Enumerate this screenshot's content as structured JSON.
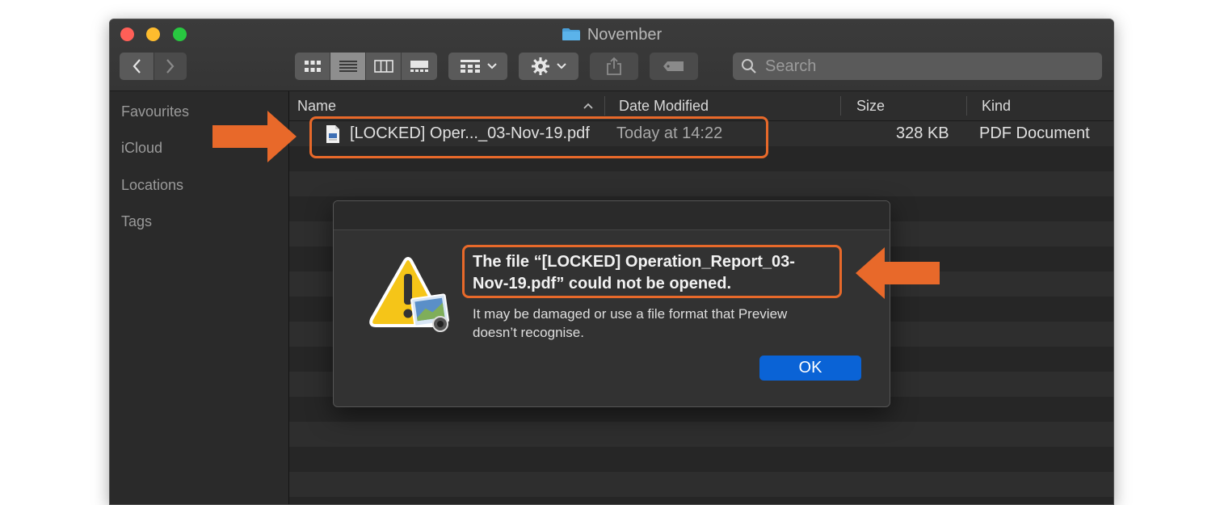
{
  "window": {
    "title": "November"
  },
  "toolbar": {
    "search_placeholder": "Search"
  },
  "sidebar": {
    "items": [
      {
        "label": "Favourites"
      },
      {
        "label": "iCloud"
      },
      {
        "label": "Locations"
      },
      {
        "label": "Tags"
      }
    ]
  },
  "columns": {
    "name": "Name",
    "date": "Date Modified",
    "size": "Size",
    "kind": "Kind"
  },
  "file": {
    "name": "[LOCKED] Oper..._03-Nov-19.pdf",
    "date": "Today at 14:22",
    "size": "328 KB",
    "kind": "PDF Document"
  },
  "dialog": {
    "title_line1": "The file “[LOCKED] Operation_Report_03-",
    "title_line2": "Nov-19.pdf” could not be opened.",
    "message_line1": "It may be damaged or use a file format that Preview",
    "message_line2": "doesn’t recognise.",
    "ok_label": "OK"
  },
  "colors": {
    "accent": "#e8692a",
    "button_blue": "#0a63d6"
  },
  "icons": [
    "folder-icon",
    "back-icon",
    "forward-icon",
    "view-icons-icon",
    "view-list-icon",
    "view-columns-icon",
    "view-gallery-icon",
    "group-icon",
    "gear-icon",
    "share-icon",
    "tag-icon",
    "search-icon",
    "pdf-file-icon",
    "warning-icon"
  ]
}
